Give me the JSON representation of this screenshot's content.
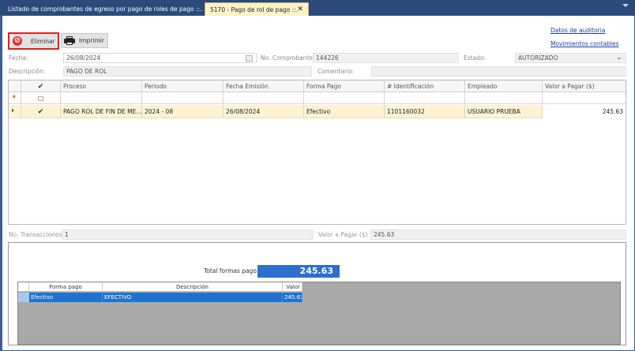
{
  "tabs": [
    {
      "label": "Listado de comprobantes de egreso por pago de roles de pago ::."
    },
    {
      "label": "5170 - Pago de rol de pago ::.",
      "close": "✕"
    }
  ],
  "toolbar": {
    "delete_label": "Eliminar",
    "delete_icon": "⊘",
    "print_label": "Imprimir"
  },
  "links": {
    "audit": "Datos de auditoria",
    "accounting": "Movimientos contables"
  },
  "form": {
    "fecha_label": "Fecha:",
    "fecha_value": "26/08/2024",
    "comprobante_label": "No. Comprobante:",
    "comprobante_value": "144226",
    "estado_label": "Estado:",
    "estado_value": "AUTORIZADO",
    "descripcion_label": "Descripción:",
    "descripcion_value": "PAGO DE ROL",
    "comentario_label": "Comentario:",
    "comentario_value": ""
  },
  "grid": {
    "columns": [
      "Proceso",
      "Periodo",
      "Fecha Emisión",
      "Forma Pago",
      "# Identificación",
      "Empleado",
      "Valor a Pagar ($)"
    ],
    "check_header": "✔",
    "filter_pin": "📍",
    "filter_check": "□",
    "rows": [
      {
        "checked": "✔",
        "proceso": "PAGO ROL DE FIN DE ME...",
        "periodo": "2024 - 08",
        "fecha_emision": "26/08/2024",
        "forma_pago": "Efectivo",
        "identificacion": "1101160032",
        "empleado": "USUARIO PRUEBA",
        "valor": "245.63"
      }
    ]
  },
  "totals": {
    "transacciones_label": "No. Transacciones",
    "transacciones_value": "1",
    "valor_label": "Valor a Pagar ($)",
    "valor_value": "245.63"
  },
  "payments": {
    "total_label": "Total formas pago:",
    "total_value": "245.63",
    "columns": [
      "Forma pago",
      "Descripción",
      "Valor"
    ],
    "rows": [
      {
        "forma": "Efectivo",
        "descripcion": "EFECTIVO",
        "valor": "245.63"
      }
    ]
  }
}
